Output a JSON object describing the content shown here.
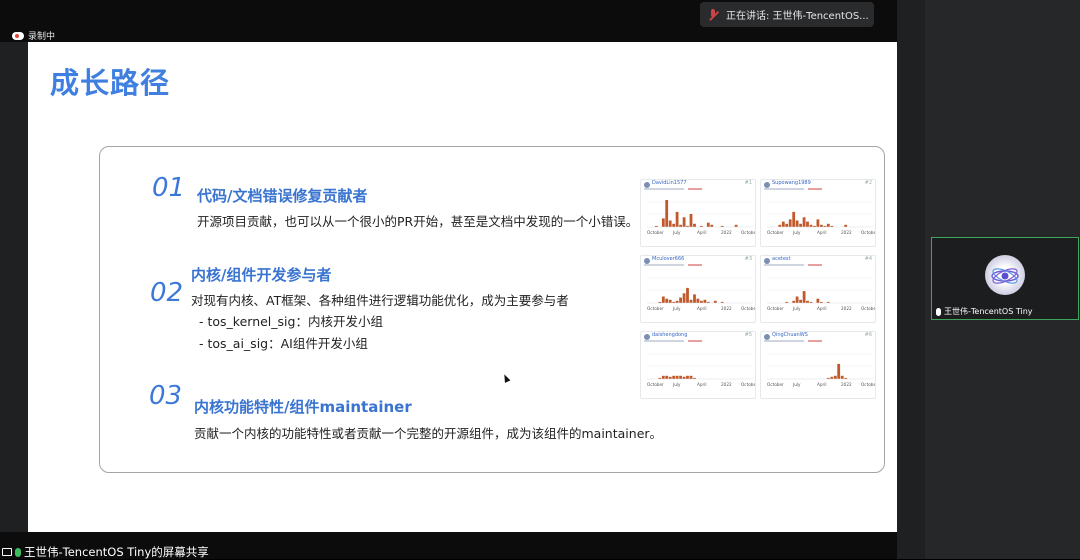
{
  "meeting": {
    "recording_label": "录制中",
    "speaking_label": "正在讲话: 王世伟-TencentOS...",
    "share_label": "王世伟-TencentOS Tiny的屏幕共享",
    "participant_name": "王世伟-TencentOS Tiny"
  },
  "slide": {
    "title": "成长路径",
    "items": [
      {
        "num": "01",
        "heading": "代码/文档错误修复贡献者",
        "desc": "开源项目贡献，也可以从一个很小的PR开始，甚至是文档中发现的一个小错误。"
      },
      {
        "num": "02",
        "heading": "内核/组件开发参与者",
        "desc": "对现有内核、AT框架、各种组件进行逻辑功能优化，成为主要参与者",
        "subs": [
          "- tos_kernel_sig：内核开发小组",
          "- tos_ai_sig：AI组件开发小组"
        ]
      },
      {
        "num": "03",
        "heading": "内核功能特性/组件maintainer",
        "desc": "贡献一个内核的功能特性或者贡献一个完整的开源组件，成为该组件的maintainer。"
      }
    ],
    "contributors": [
      {
        "name": "DavidLin1577",
        "rank": "#1",
        "axis": [
          "October",
          "July",
          "April",
          "2022",
          "October"
        ]
      },
      {
        "name": "Supowang1989",
        "rank": "#2",
        "axis": [
          "October",
          "July",
          "April",
          "2022",
          "October"
        ]
      },
      {
        "name": "Mculover666",
        "rank": "#3",
        "axis": [
          "October",
          "July",
          "April",
          "2022",
          "October"
        ]
      },
      {
        "name": "acetest",
        "rank": "#4",
        "axis": [
          "October",
          "July",
          "April",
          "2022",
          "October"
        ]
      },
      {
        "name": "daishengdong",
        "rank": "#5",
        "axis": [
          "October",
          "July",
          "April",
          "2022",
          "October"
        ]
      },
      {
        "name": "QingChuanWS",
        "rank": "#6",
        "axis": [
          "October",
          "July",
          "April",
          "2022",
          "October"
        ]
      }
    ],
    "chart_values": [
      [
        0,
        0,
        1,
        0,
        8,
        25,
        6,
        3,
        14,
        2,
        9,
        1,
        12,
        3,
        0,
        1,
        0,
        4,
        2,
        0,
        0,
        1,
        0,
        0,
        0,
        2,
        0,
        0,
        0,
        0
      ],
      [
        0,
        0,
        0,
        2,
        5,
        3,
        7,
        14,
        6,
        3,
        9,
        5,
        2,
        1,
        7,
        2,
        1,
        3,
        1,
        0,
        0,
        0,
        2,
        0,
        0,
        0,
        0,
        0,
        0,
        0
      ],
      [
        0,
        0,
        0,
        1,
        6,
        4,
        3,
        1,
        2,
        5,
        9,
        14,
        3,
        8,
        4,
        2,
        3,
        1,
        0,
        2,
        0,
        1,
        0,
        0,
        0,
        0,
        0,
        0,
        0,
        0
      ],
      [
        0,
        0,
        0,
        0,
        0,
        1,
        0,
        2,
        6,
        3,
        11,
        2,
        1,
        0,
        4,
        1,
        0,
        1,
        0,
        0,
        0,
        0,
        0,
        0,
        0,
        0,
        0,
        0,
        0,
        0
      ],
      [
        0,
        0,
        0,
        1,
        3,
        3,
        2,
        3,
        3,
        3,
        2,
        3,
        3,
        1,
        0,
        0,
        0,
        0,
        0,
        0,
        0,
        0,
        0,
        0,
        0,
        0,
        0,
        0,
        0,
        0
      ],
      [
        0,
        0,
        0,
        0,
        0,
        0,
        0,
        0,
        0,
        0,
        0,
        0,
        0,
        0,
        0,
        0,
        0,
        1,
        2,
        3,
        14,
        3,
        1,
        0,
        0,
        0,
        0,
        0,
        0,
        0
      ]
    ],
    "chart_color": "#c2592b"
  }
}
